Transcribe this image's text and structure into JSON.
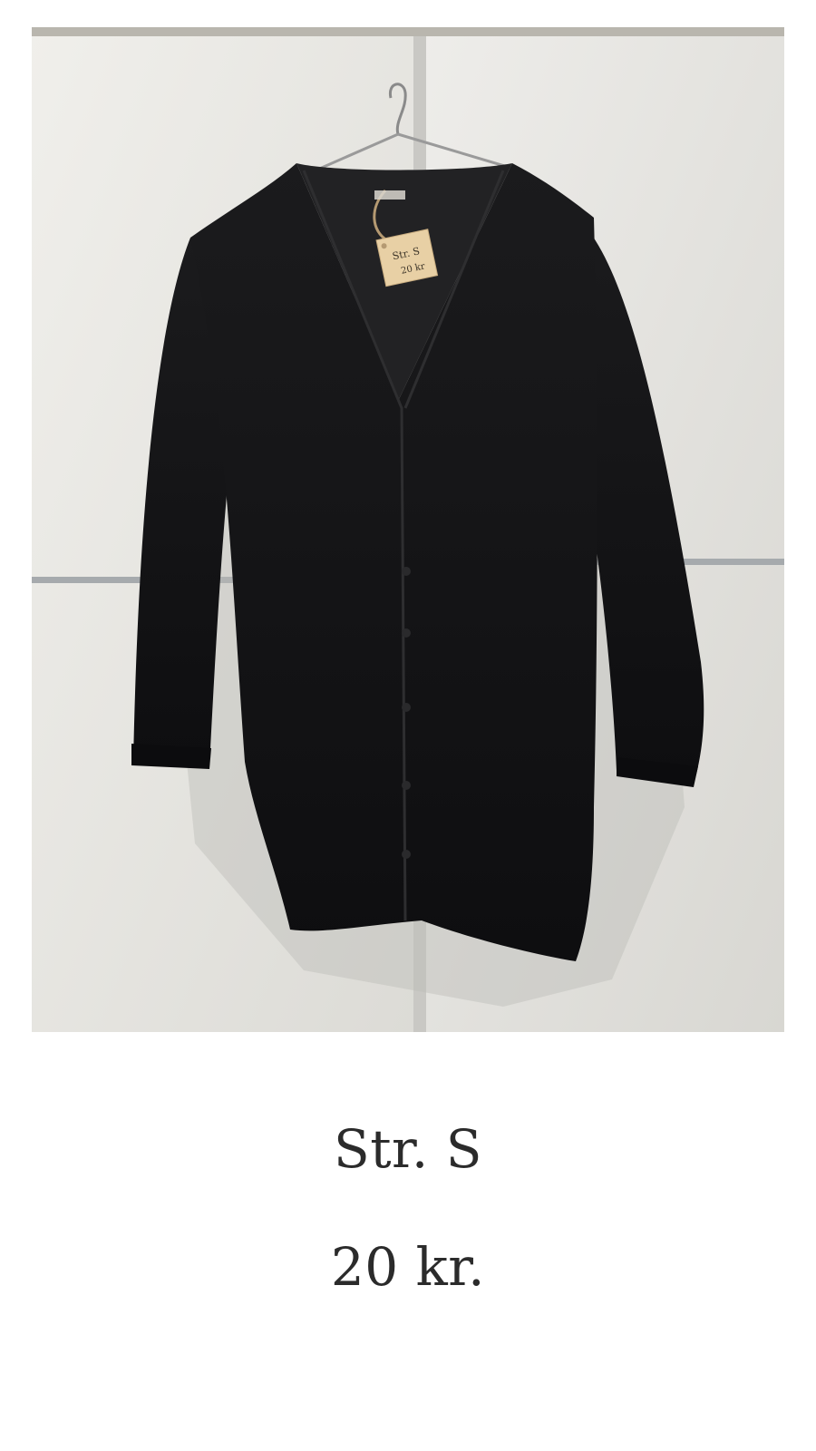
{
  "product": {
    "size_label": "Str. S",
    "price_label": "20 kr.",
    "photo": {
      "subject": "black knit cardigan on wire hanger",
      "garment_color": "#141414",
      "background_color": "#e9e8e3",
      "tag": {
        "line1": "Str. S",
        "line2": "20 kr"
      }
    }
  }
}
